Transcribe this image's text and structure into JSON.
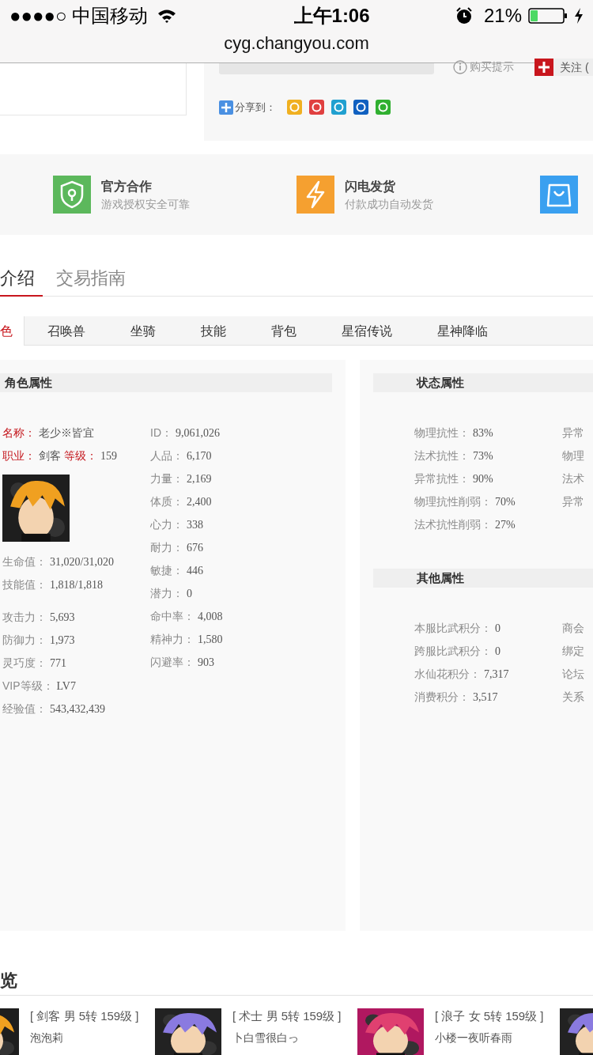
{
  "status_bar": {
    "carrier": "●●●●○ 中国移动",
    "time": "上午1:06",
    "battery": "21%"
  },
  "address_bar": {
    "url": "cyg.changyou.com"
  },
  "purchase": {
    "tip": "购买提示",
    "follow": "关注 (",
    "share_label": "分享到："
  },
  "features": [
    {
      "kind": "shield",
      "title": "官方合作",
      "subtitle": "游戏授权安全可靠"
    },
    {
      "kind": "bolt",
      "title": "闪电发货",
      "subtitle": "付款成功自动发货"
    },
    {
      "kind": "bag"
    }
  ],
  "tabs": [
    {
      "label": "介绍",
      "selected": true
    },
    {
      "label": "交易指南",
      "selected": false
    }
  ],
  "sub_tabs": [
    {
      "label": "色",
      "selected": true
    },
    {
      "label": "召唤兽",
      "selected": false
    },
    {
      "label": "坐骑",
      "selected": false
    },
    {
      "label": "技能",
      "selected": false
    },
    {
      "label": "背包",
      "selected": false
    },
    {
      "label": "星宿传说",
      "selected": false
    },
    {
      "label": "星神降临",
      "selected": false
    }
  ],
  "character_panel": {
    "title": "角色属性",
    "name": {
      "label": "名称：",
      "value": "老少※皆宜"
    },
    "job": {
      "label": "职业：",
      "value": "剑客"
    },
    "level": {
      "label": "等级：",
      "value": "159"
    },
    "vitals": [
      {
        "label": "生命值：",
        "value": "31,020/31,020"
      },
      {
        "label": "技能值：",
        "value": "1,818/1,818"
      }
    ],
    "combat": [
      {
        "label": "攻击力：",
        "value": "5,693"
      },
      {
        "label": "防御力：",
        "value": "1,973"
      },
      {
        "label": "灵巧度：",
        "value": "771"
      },
      {
        "label": "VIP等级：",
        "value": "LV7"
      },
      {
        "label": "经验值：",
        "value": "543,432,439"
      }
    ],
    "column_2": [
      {
        "label": "ID：",
        "value": "9,061,026"
      },
      {
        "label": "人品：",
        "value": "6,170"
      },
      {
        "label": "力量：",
        "value": "2,169"
      },
      {
        "label": "体质：",
        "value": "2,400"
      },
      {
        "label": "心力：",
        "value": "338"
      },
      {
        "label": "耐力：",
        "value": "676"
      },
      {
        "label": "敏捷：",
        "value": "446"
      },
      {
        "label": "潜力：",
        "value": "0"
      },
      {
        "label": "命中率：",
        "value": "4,008"
      },
      {
        "label": "精神力：",
        "value": "1,580"
      },
      {
        "label": "闪避率：",
        "value": "903"
      }
    ]
  },
  "status_panel": {
    "title": "状态属性",
    "column_1": [
      {
        "label": "物理抗性：",
        "value": "83%"
      },
      {
        "label": "法术抗性：",
        "value": "73%"
      },
      {
        "label": "异常抗性：",
        "value": "90%"
      },
      {
        "label": "物理抗性削弱：",
        "value": "70%"
      },
      {
        "label": "法术抗性削弱：",
        "value": "27%"
      }
    ],
    "column_2": [
      "异常",
      "物理",
      "法术",
      "异常"
    ]
  },
  "other_panel": {
    "title": "其他属性",
    "column_1": [
      {
        "label": "本服比武积分：",
        "value": "0"
      },
      {
        "label": "跨服比武积分：",
        "value": "0"
      },
      {
        "label": "水仙花积分：",
        "value": "7,317"
      },
      {
        "label": "消费积分：",
        "value": "3,517"
      }
    ],
    "column_2": [
      "商会",
      "绑定",
      "论坛",
      "关系"
    ]
  },
  "browse": {
    "title": "览",
    "items": [
      {
        "kind": "card",
        "info": "[ 剑客 男 5转 159级 ]",
        "name": "泡泡莉"
      },
      {
        "kind": "card",
        "info": "[ 术士 男 5转 159级 ]",
        "name": "卜白雪很白っ"
      },
      {
        "kind": "card",
        "info": "[ 浪子 女 5转 159级 ]",
        "name": "小楼一夜听春雨"
      },
      {
        "kind": "picture"
      }
    ]
  }
}
